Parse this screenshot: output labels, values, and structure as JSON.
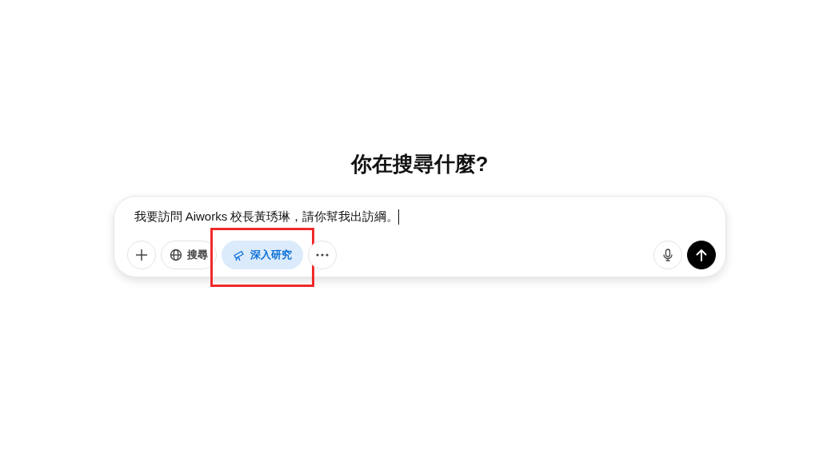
{
  "heading": "你在搜尋什麼?",
  "composer": {
    "value": "我要訪問 Aiworks 校長黃琇琳，請你幫我出訪綱。",
    "tools": [
      {
        "kind": "add",
        "selected": false,
        "highlighted": false
      },
      {
        "kind": "search",
        "label": "搜尋",
        "selected": false,
        "highlighted": false
      },
      {
        "kind": "research",
        "label": "深入研究",
        "selected": true,
        "highlighted": true
      },
      {
        "kind": "more",
        "selected": false,
        "highlighted": false
      }
    ],
    "actions": [
      {
        "kind": "mic"
      },
      {
        "kind": "send"
      }
    ]
  }
}
